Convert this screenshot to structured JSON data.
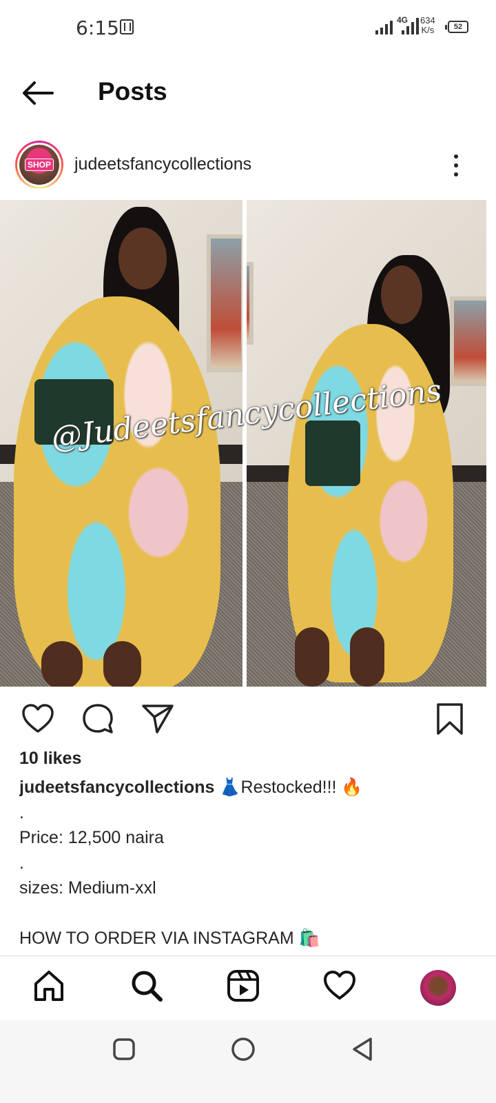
{
  "status_bar": {
    "time": "6:15",
    "network_type": "4G",
    "net_speed_value": "634",
    "net_speed_unit": "K/s",
    "battery": "52"
  },
  "header": {
    "title": "Posts"
  },
  "post": {
    "username": "judeetsfancycollections",
    "avatar_badge": "SHOP",
    "watermark": "@Judeetsfancycollections",
    "likes": "10 likes",
    "caption": {
      "username": "judeetsfancycollections",
      "first_line": "👗Restocked!!! 🔥",
      "lines": [
        ".",
        "Price: 12,500 naira",
        ".",
        "sizes: Medium-xxl",
        "",
        "HOW TO ORDER VIA INSTAGRAM 🛍️"
      ]
    }
  },
  "colors": {
    "accent_ring": "#d6249f",
    "text": "#262626"
  },
  "icons": {
    "back": "arrow-left-icon",
    "more": "more-vertical-icon",
    "like": "heart-icon",
    "comment": "comment-icon",
    "share": "send-icon",
    "save": "bookmark-icon",
    "home": "home-icon",
    "search": "search-icon",
    "reels": "reels-icon",
    "activity": "heart-icon",
    "profile": "profile-avatar"
  }
}
